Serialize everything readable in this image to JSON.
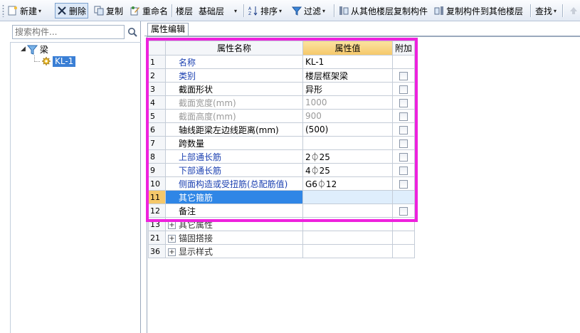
{
  "toolbar": {
    "new_label": "新建",
    "delete_label": "删除",
    "copy_label": "复制",
    "rename_label": "重命名",
    "floor_label": "楼层",
    "floor_value": "基础层",
    "sort_label": "排序",
    "filter_label": "过滤",
    "copy_from_floor_label": "从其他楼层复制构件",
    "copy_to_floor_label": "复制构件到其他楼层",
    "find_label": "查找"
  },
  "left": {
    "search_placeholder": "搜索构件...",
    "tree": {
      "category_label": "梁",
      "item_label": "KL-1"
    }
  },
  "right": {
    "tab_label": "属性编辑",
    "columns": {
      "name": "属性名称",
      "value": "属性值",
      "extra": "附加"
    },
    "rows": [
      {
        "num": "1",
        "name": "名称",
        "value": "KL-1"
      },
      {
        "num": "2",
        "name": "类别",
        "value": "楼层框架梁"
      },
      {
        "num": "3",
        "name": "截面形状",
        "value": "异形"
      },
      {
        "num": "4",
        "name": "截面宽度(mm)",
        "value": "1000"
      },
      {
        "num": "5",
        "name": "截面高度(mm)",
        "value": "900"
      },
      {
        "num": "6",
        "name": "轴线距梁左边线距离(mm)",
        "value": "(500)"
      },
      {
        "num": "7",
        "name": "跨数量",
        "value": ""
      },
      {
        "num": "8",
        "name": "上部通长筋",
        "value": "2⏀25"
      },
      {
        "num": "9",
        "name": "下部通长筋",
        "value": "4⏀25"
      },
      {
        "num": "10",
        "name": "侧面构造或受扭筋(总配筋值)",
        "value": "G6⏀12"
      },
      {
        "num": "11",
        "name": "其它箍筋",
        "value": ""
      },
      {
        "num": "12",
        "name": "备注",
        "value": ""
      }
    ],
    "groups": [
      {
        "num": "13",
        "name": "其它属性"
      },
      {
        "num": "21",
        "name": "锚固搭接"
      },
      {
        "num": "36",
        "name": "显示样式"
      }
    ]
  },
  "colors": {
    "highlight": "#ee22dd",
    "selected_row": "#2f86e6",
    "value_header": "#f5c86a",
    "blue_text": "#1a3fb0"
  }
}
